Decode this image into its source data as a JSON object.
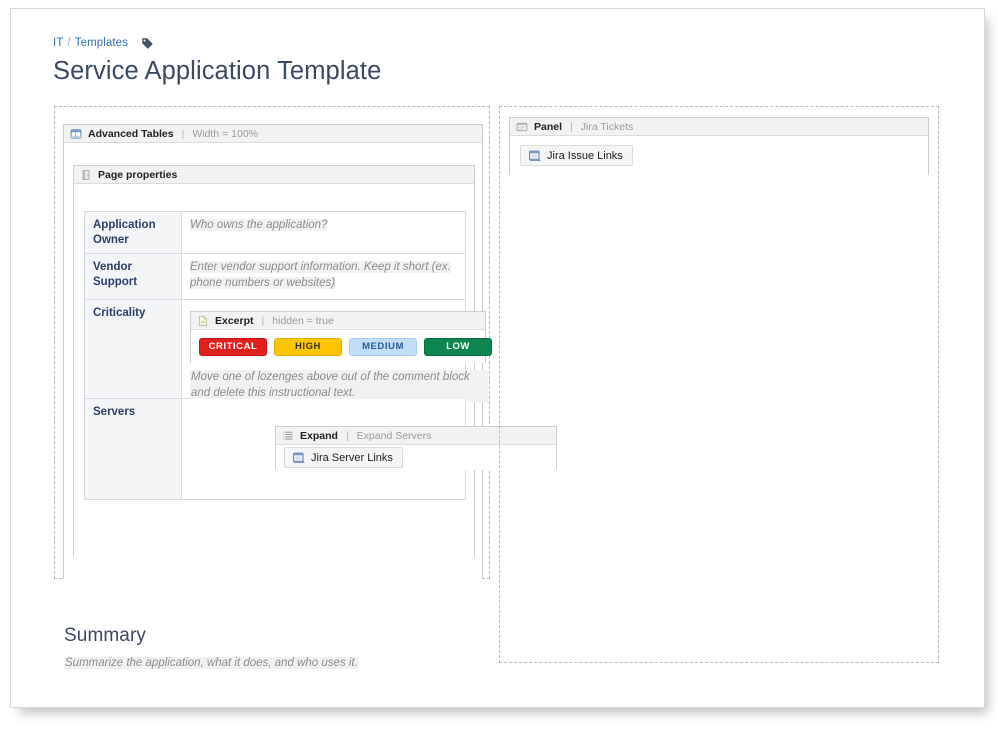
{
  "breadcrumb": {
    "items": [
      {
        "label": "IT",
        "name": "breadcrumb-link-it"
      },
      {
        "label": "Templates",
        "name": "breadcrumb-link-templates"
      }
    ],
    "separator": "/",
    "tag_icon": "tag-icon"
  },
  "page_title": "Service Application Template",
  "left_column": {
    "advanced_tables_macro": {
      "icon": "table-macro-icon",
      "name": "Advanced Tables",
      "pipe": "|",
      "param": "Width = 100%"
    },
    "page_properties_macro": {
      "icon": "page-properties-icon",
      "name": "Page properties"
    },
    "properties_table": {
      "rows": [
        {
          "key": "Application Owner",
          "value": "Who owns the application?",
          "type": "text"
        },
        {
          "key": "Vendor Support",
          "value": "Enter vendor support information. Keep it short (ex. phone numbers or websites)",
          "type": "text"
        },
        {
          "key": "Criticality",
          "type": "criticality"
        },
        {
          "key": "Servers",
          "type": "servers"
        }
      ]
    },
    "excerpt_macro": {
      "icon": "excerpt-page-icon",
      "name": "Excerpt",
      "pipe": "|",
      "param": "hidden = true"
    },
    "lozenges": [
      {
        "label": "CRITICAL",
        "bg": "#e01f1f",
        "fg": "#ffffff",
        "border": "#c41616"
      },
      {
        "label": "HIGH",
        "bg": "#fdc400",
        "fg": "#333333",
        "border": "#e0ad00"
      },
      {
        "label": "MEDIUM",
        "bg": "#c2ddfa",
        "fg": "#2a5d99",
        "border": "#a8cdf3"
      },
      {
        "label": "LOW",
        "bg": "#0f8551",
        "fg": "#ffffff",
        "border": "#0b6e43"
      }
    ],
    "criticality_note": "Move one of lozenges above out of the comment block and delete this instructional text.",
    "expand_macro": {
      "icon": "expand-macro-icon",
      "name": "Expand",
      "pipe": "|",
      "param": "Expand Servers"
    },
    "jira_server_links_chip": {
      "icon": "jira-macro-icon",
      "label": "Jira Server Links"
    },
    "summary_heading": "Summary",
    "summary_text": "Summarize the application, what it does, and who uses it."
  },
  "right_column": {
    "panel_macro": {
      "icon": "panel-macro-icon",
      "name": "Panel",
      "pipe": "|",
      "param": "Jira Tickets"
    },
    "jira_issue_links_chip": {
      "icon": "jira-macro-icon",
      "label": "Jira Issue Links"
    }
  },
  "colors": {
    "link": "#3572b0",
    "heading": "#3b4a63",
    "table_key_text": "#2c3e6b",
    "placeholder": "#8c8c8c"
  }
}
